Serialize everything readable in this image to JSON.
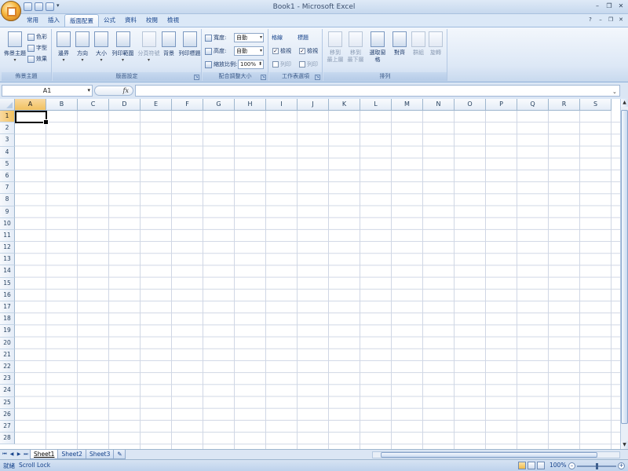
{
  "window": {
    "title": "Book1 - Microsoft Excel"
  },
  "qat": [
    "save-icon",
    "undo-icon",
    "redo-icon",
    "customize-icon"
  ],
  "tabs": [
    {
      "label": "常用"
    },
    {
      "label": "插入"
    },
    {
      "label": "版面配置",
      "active": true
    },
    {
      "label": "公式"
    },
    {
      "label": "資料"
    },
    {
      "label": "校閱"
    },
    {
      "label": "檢視"
    }
  ],
  "ribbon": {
    "themes": {
      "label": "佈景主題",
      "big": "佈景主題",
      "small": [
        "色彩",
        "字型",
        "效果"
      ]
    },
    "page_setup": {
      "label": "版面設定",
      "buttons": [
        "邊界",
        "方向",
        "大小",
        "列印範圍",
        "分頁符號",
        "背景",
        "列印標題"
      ]
    },
    "scale": {
      "label": "配合調整大小",
      "width_label": "寬度:",
      "width_value": "自動",
      "height_label": "高度:",
      "height_value": "自動",
      "zoom_label": "縮放比例:",
      "zoom_value": "100%"
    },
    "sheet_options": {
      "label": "工作表選項",
      "gridlines_head": "格線",
      "headings_head": "標題",
      "view": "檢視",
      "print": "列印"
    },
    "arrange": {
      "label": "排列",
      "buttons": [
        "移到\n最上層",
        "移到\n最下層",
        "選取窗格",
        "對齊",
        "群組",
        "旋轉"
      ]
    }
  },
  "formula_bar": {
    "name_box": "A1",
    "fx": "fx",
    "value": ""
  },
  "columns": [
    "A",
    "B",
    "C",
    "D",
    "E",
    "F",
    "G",
    "H",
    "I",
    "J",
    "K",
    "L",
    "M",
    "N",
    "O",
    "P",
    "Q",
    "R",
    "S"
  ],
  "rows": [
    "1",
    "2",
    "3",
    "4",
    "5",
    "6",
    "7",
    "8",
    "9",
    "10",
    "11",
    "12",
    "13",
    "14",
    "15",
    "16",
    "17",
    "18",
    "19",
    "20",
    "21",
    "22",
    "23",
    "24",
    "25",
    "26",
    "27",
    "28"
  ],
  "sheets": [
    {
      "label": "Sheet1",
      "active": true
    },
    {
      "label": "Sheet2"
    },
    {
      "label": "Sheet3"
    }
  ],
  "status": {
    "ready": "就緒",
    "scroll_lock": "Scroll Lock",
    "zoom": "100%"
  }
}
